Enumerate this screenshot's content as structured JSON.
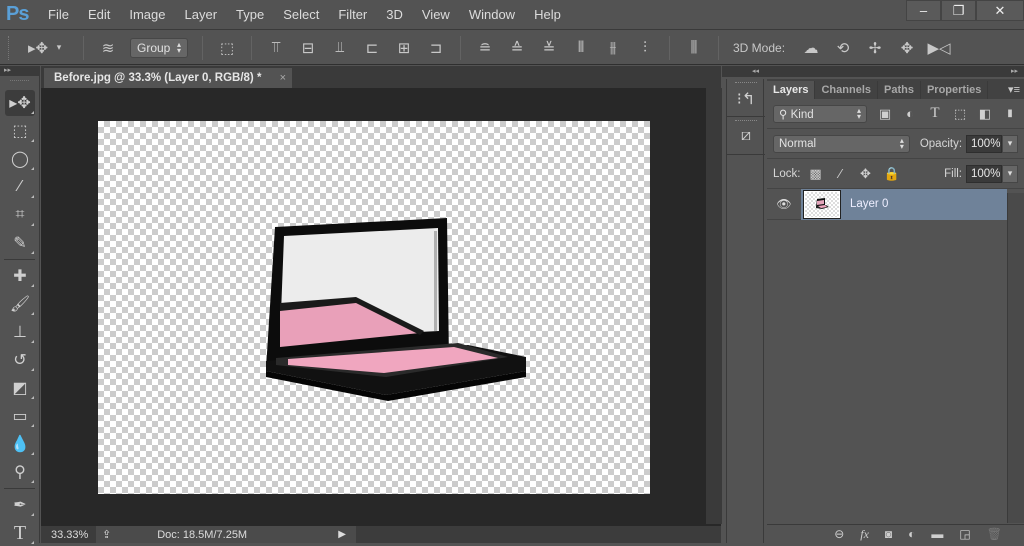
{
  "app": {
    "logo": "Ps"
  },
  "menu": [
    "File",
    "Edit",
    "Image",
    "Layer",
    "Type",
    "Select",
    "Filter",
    "3D",
    "View",
    "Window",
    "Help"
  ],
  "window_controls": {
    "minimize": "–",
    "restore": "❐",
    "close": "✕"
  },
  "options_bar": {
    "auto_select_target": "Group",
    "mode_label": "3D Mode:"
  },
  "document": {
    "tab_title": "Before.jpg @ 33.3% (Layer 0, RGB/8) *",
    "tab_close": "×",
    "zoom": "33.33%",
    "doc_info": "Doc: 18.5M/7.25M"
  },
  "layers_panel": {
    "tabs": [
      {
        "label": "Layers",
        "active": true
      },
      {
        "label": "Channels",
        "active": false
      },
      {
        "label": "Paths",
        "active": false
      },
      {
        "label": "Properties",
        "active": false
      }
    ],
    "filter_kind": "Kind",
    "blend_mode": "Normal",
    "opacity_label": "Opacity:",
    "opacity": "100%",
    "lock_label": "Lock:",
    "fill_label": "Fill:",
    "fill": "100%",
    "layers": [
      {
        "name": "Layer 0",
        "visible": true,
        "selected": true
      }
    ]
  },
  "colors": {
    "selected_layer": "#6f8299",
    "ps_logo": "#5aa0d8",
    "blush_pink": "#f0a6bf"
  }
}
